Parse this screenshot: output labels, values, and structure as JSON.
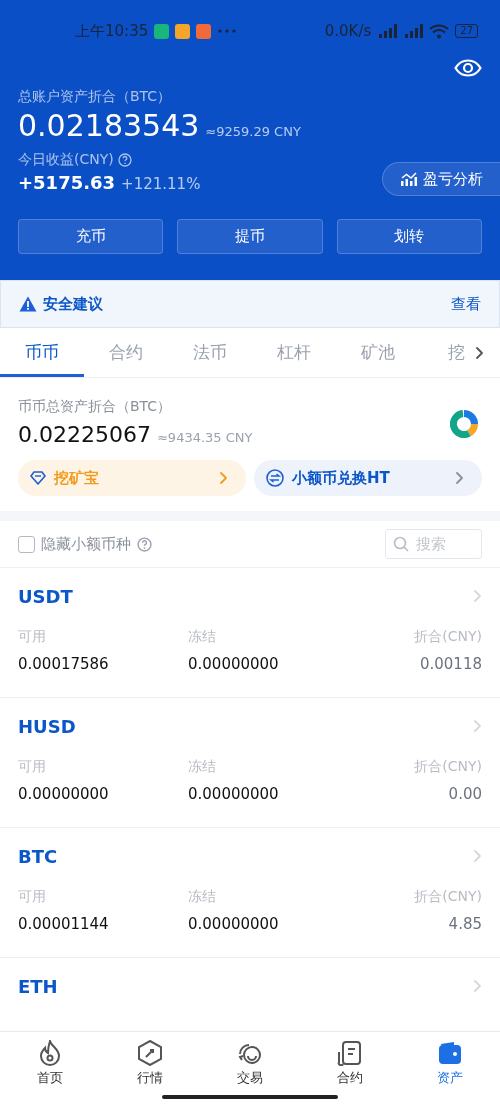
{
  "status_bar": {
    "time": "上午10:35",
    "net_speed": "0.0K/s",
    "battery": "27"
  },
  "account": {
    "title": "总账户资产折合（BTC）",
    "balance": "0.02183543",
    "balance_cny": "≈9259.29 CNY",
    "profit_label": "今日收益(CNY)",
    "profit": "+5175.63",
    "profit_pct": "+121.11%",
    "analysis_button": "盈亏分析"
  },
  "actions": [
    "充币",
    "提币",
    "划转"
  ],
  "security": {
    "text": "安全建议",
    "link": "查看"
  },
  "tabs": [
    {
      "label": "币币",
      "selected": true
    },
    {
      "label": "合约",
      "selected": false
    },
    {
      "label": "法币",
      "selected": false
    },
    {
      "label": "杠杆",
      "selected": false
    },
    {
      "label": "矿池",
      "selected": false
    },
    {
      "label": "挖",
      "selected": false
    }
  ],
  "spot": {
    "title": "币币总资产折合（BTC）",
    "balance": "0.02225067",
    "balance_cny": "≈9434.35 CNY"
  },
  "promos": [
    {
      "label": "挖矿宝",
      "kind": "mining"
    },
    {
      "label": "小额币兑换HT",
      "kind": "exchange"
    }
  ],
  "filter": {
    "label": "隐藏小额币种",
    "checked": false,
    "search_placeholder": "搜索"
  },
  "coins": [
    {
      "name": "USDT",
      "fields": [
        {
          "label": "可用",
          "value": "0.00017586"
        },
        {
          "label": "冻结",
          "value": "0.00000000"
        },
        {
          "label": "折合(CNY)",
          "value": "0.00118"
        }
      ]
    },
    {
      "name": "HUSD",
      "fields": [
        {
          "label": "可用",
          "value": "0.00000000"
        },
        {
          "label": "冻结",
          "value": "0.00000000"
        },
        {
          "label": "折合(CNY)",
          "value": "0.00"
        }
      ]
    },
    {
      "name": "BTC",
      "fields": [
        {
          "label": "可用",
          "value": "0.00001144"
        },
        {
          "label": "冻结",
          "value": "0.00000000"
        },
        {
          "label": "折合(CNY)",
          "value": "4.85"
        }
      ]
    },
    {
      "name": "ETH"
    }
  ],
  "nav": [
    {
      "label": "首页",
      "kind": "home",
      "selected": false
    },
    {
      "label": "行情",
      "kind": "market",
      "selected": false
    },
    {
      "label": "交易",
      "kind": "trade",
      "selected": false
    },
    {
      "label": "合约",
      "kind": "contract",
      "selected": false
    },
    {
      "label": "资产",
      "kind": "assets",
      "selected": true
    }
  ]
}
